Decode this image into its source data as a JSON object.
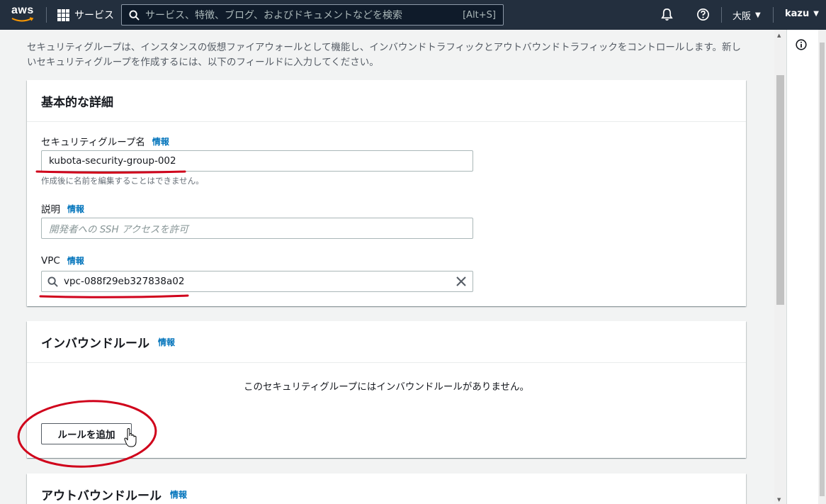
{
  "nav": {
    "logo_text": "aws",
    "services_label": "サービス",
    "search_placeholder": "サービス、特徴、ブログ、およびドキュメントなどを検索",
    "search_shortcut": "[Alt+S]",
    "region": "大阪",
    "user": "kazu"
  },
  "intro": "セキュリティグループは、インスタンスの仮想ファイアウォールとして機能し、インバウンドトラフィックとアウトバウンドトラフィックをコントロールします。新しいセキュリティグループを作成するには、以下のフィールドに入力してください。",
  "basic": {
    "title": "基本的な詳細",
    "name_label": "セキュリティグループ名",
    "info": "情報",
    "name_value": "kubota-security-group-002",
    "name_hint": "作成後に名前を編集することはできません。",
    "desc_label": "説明",
    "desc_placeholder": "開発者への SSH アクセスを許可",
    "vpc_label": "VPC",
    "vpc_value": "vpc-088f29eb327838a02"
  },
  "inbound": {
    "title": "インバウンドルール",
    "info": "情報",
    "empty_message": "このセキュリティグループにはインバウンドルールがありません。",
    "add_button": "ルールを追加"
  },
  "outbound": {
    "title": "アウトバウンドルール",
    "info": "情報"
  },
  "colors": {
    "nav_bg": "#232f3e",
    "link": "#0073bb",
    "annotation": "#d0021b",
    "aws_orange": "#ff9900"
  },
  "icons": [
    "grid-icon",
    "search-icon",
    "bell-icon",
    "help-icon",
    "info-icon",
    "clear-icon",
    "hand-cursor-icon"
  ]
}
